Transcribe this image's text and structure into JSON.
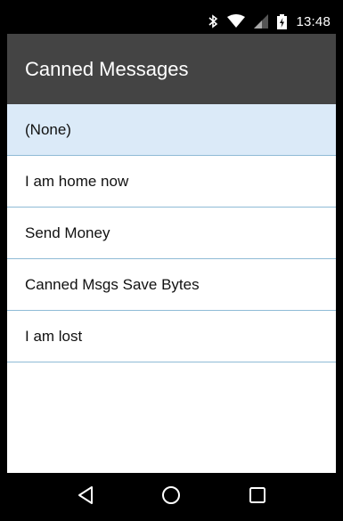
{
  "status_bar": {
    "time": "13:48",
    "icons": [
      "bluetooth-icon",
      "wifi-icon",
      "signal-icon",
      "battery-charging-icon"
    ]
  },
  "app_bar": {
    "title": "Canned Messages"
  },
  "messages": {
    "items": [
      {
        "label": "(None)",
        "selected": true
      },
      {
        "label": "I am home now",
        "selected": false
      },
      {
        "label": "Send Money",
        "selected": false
      },
      {
        "label": "Canned Msgs Save Bytes",
        "selected": false
      },
      {
        "label": "I am lost",
        "selected": false
      }
    ]
  },
  "nav_bar": {
    "buttons": [
      "back-icon",
      "home-icon",
      "recents-icon"
    ]
  },
  "colors": {
    "app_bar": "#444444",
    "selected_row": "#dbeaf8",
    "divider": "#8fbbd6",
    "system_bars": "#000000"
  }
}
